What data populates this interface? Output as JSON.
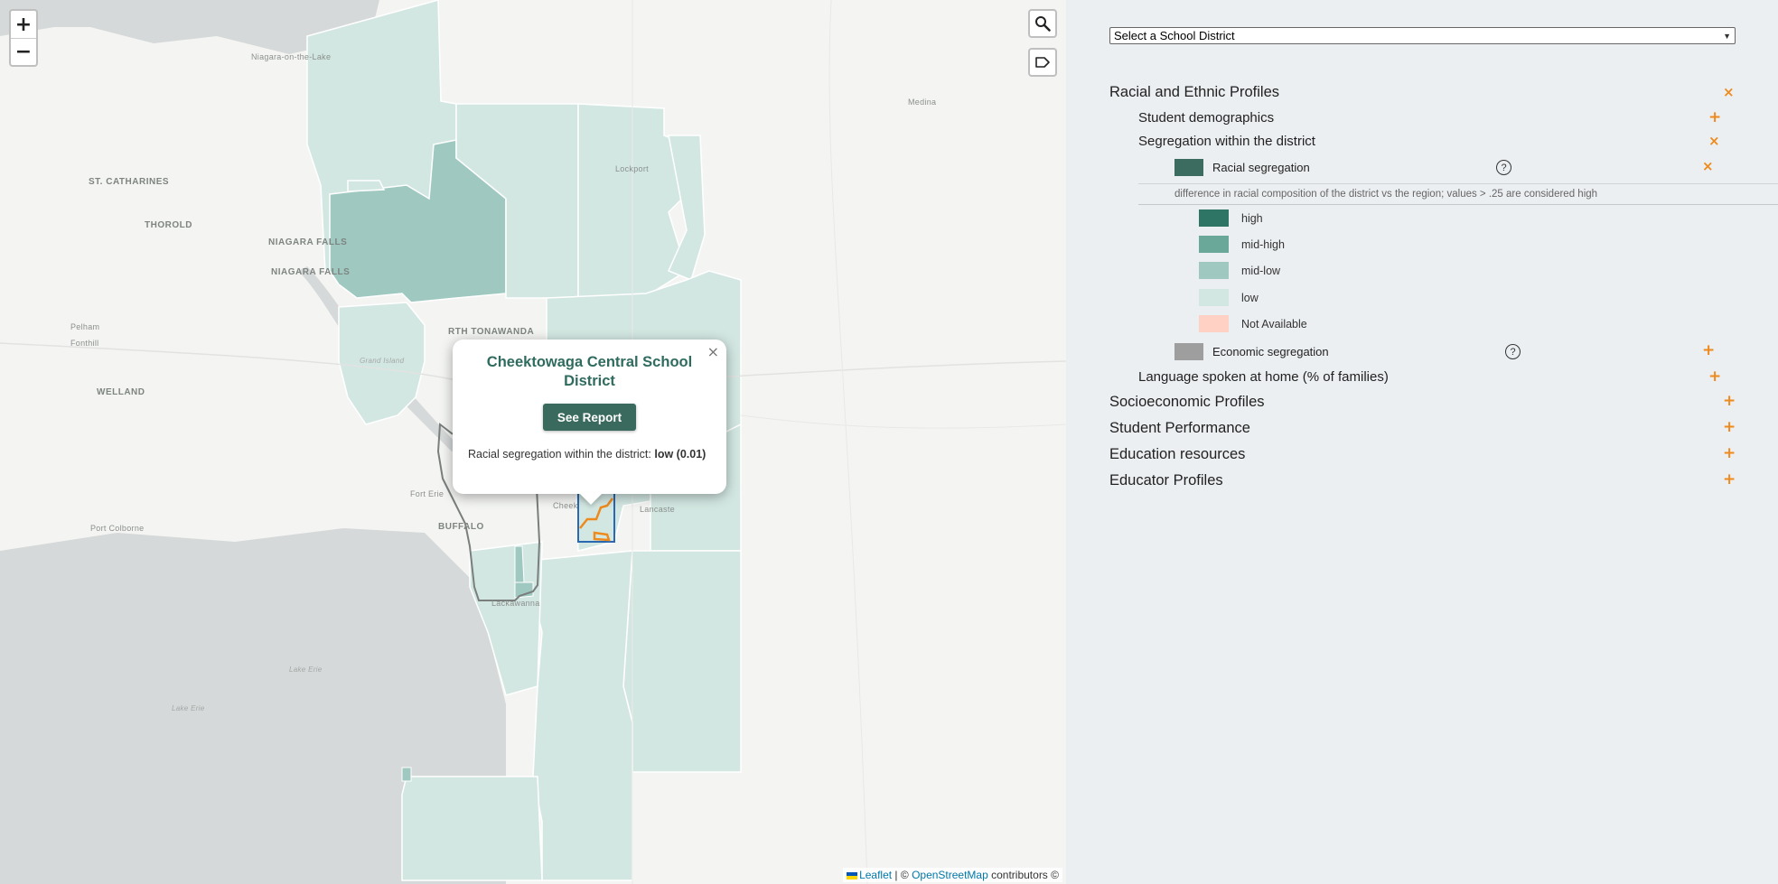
{
  "map": {
    "zoom_in": "+",
    "zoom_out": "−",
    "search_icon": "search-icon",
    "label_icon": "label-icon",
    "labels": {
      "niagara_on_lake": "Niagara-on-the-Lake",
      "st_catharines": "ST. CATHARINES",
      "thorold": "THOROLD",
      "niagara_falls_1": "NIAGARA FALLS",
      "niagara_falls_2": "NIAGARA FALLS",
      "pelham": "Pelham",
      "fonthill": "Fonthill",
      "welland": "WELLAND",
      "lockport": "Lockport",
      "medina": "Medina",
      "n_tonawanda": "RTH TONAWANDA",
      "grand_island": "Grand Island",
      "fort_erie": "Fort Erie",
      "buffalo": "BUFFALO",
      "cheek": "Cheek",
      "lancaster": "Lancaste",
      "port_colborne": "Port Colborne",
      "lackawanna": "Lackawanna",
      "lake_erie_1": "Lake Erie",
      "lake_erie_2": "Lake Erie"
    },
    "popup": {
      "close": "×",
      "title": "Cheektowaga Central School District",
      "button": "See Report",
      "text_prefix": "Racial segregation within the district: ",
      "text_value": "low (0.01)"
    },
    "attribution": {
      "leaflet": "Leaflet",
      "sep": " | © ",
      "osm": "OpenStreetMap",
      "suffix": " contributors ©"
    }
  },
  "sidebar": {
    "select_placeholder": "Select a School District",
    "sections": [
      {
        "label": "Racial and Ethnic Profiles",
        "toggle": "×"
      },
      {
        "label": "Student demographics",
        "toggle": "+"
      },
      {
        "label": "Segregation within the district",
        "toggle": "×"
      },
      {
        "label": "Racial segregation",
        "toggle": "×"
      },
      {
        "label": "Economic segregation",
        "toggle": "+"
      },
      {
        "label": "Language spoken at home (% of families)",
        "toggle": "+"
      },
      {
        "label": "Socioeconomic Profiles",
        "toggle": "+"
      },
      {
        "label": "Student Performance",
        "toggle": "+"
      },
      {
        "label": "Education resources",
        "toggle": "+"
      },
      {
        "label": "Educator Profiles",
        "toggle": "+"
      }
    ],
    "help": "?",
    "description": "difference in racial composition of the district vs the region; values > .25 are considered high",
    "legend": [
      {
        "label": "high",
        "color": "#2e7565"
      },
      {
        "label": "mid-high",
        "color": "#6aa89a"
      },
      {
        "label": "mid-low",
        "color": "#9fc9c0"
      },
      {
        "label": "low",
        "color": "#d3e7e2"
      },
      {
        "label": "Not Available",
        "color": "#ffd1c4"
      }
    ],
    "swatch_racial": "#3c6b60",
    "swatch_economic": "#9e9e9e"
  }
}
